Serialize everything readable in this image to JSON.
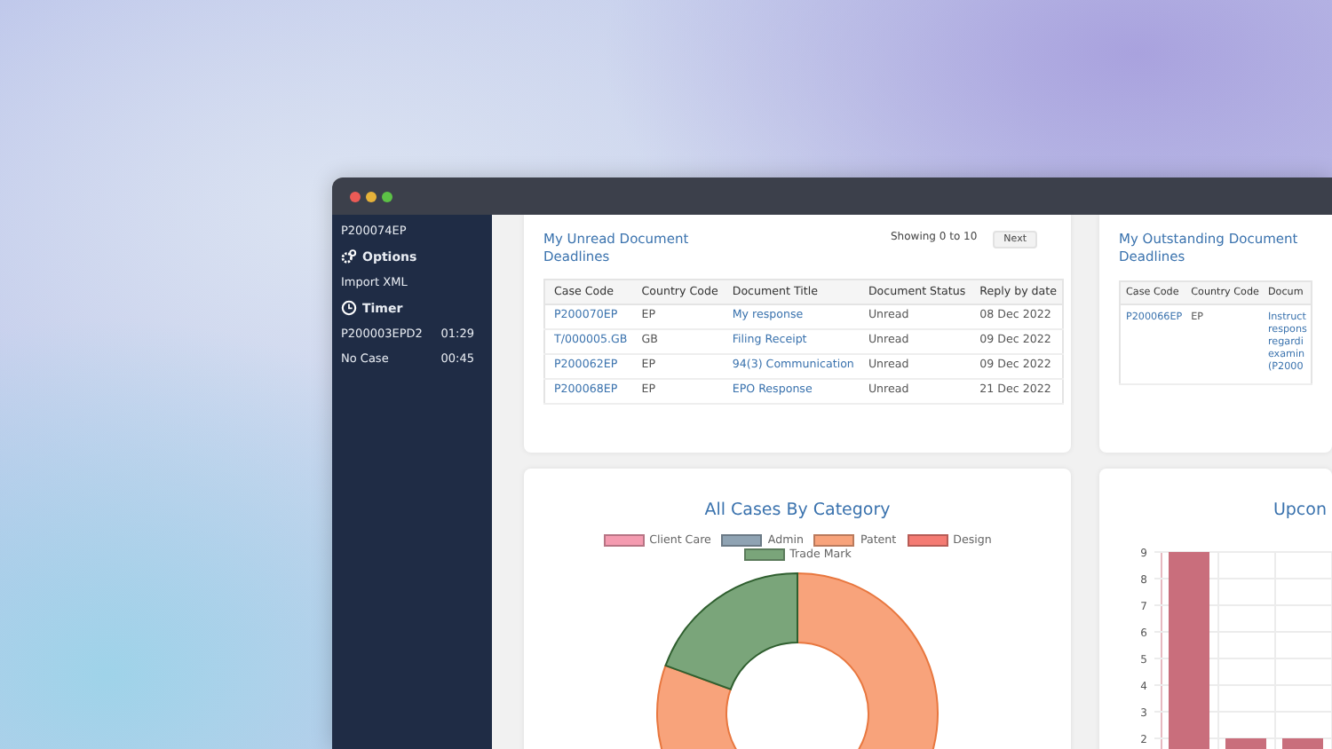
{
  "sidebar": {
    "current_case": "P200074EP",
    "sections": [
      {
        "title": "Options",
        "items": [
          {
            "label": "Import XML"
          }
        ]
      },
      {
        "title": "Timer",
        "items": [
          {
            "label": "P200003EPD2",
            "time": "01:29"
          },
          {
            "label": "No Case",
            "time": "00:45"
          }
        ]
      }
    ]
  },
  "unread_deadlines": {
    "title": "My Unread Document Deadlines",
    "pager": {
      "text": "Showing 0 to 10",
      "button": "Next"
    },
    "columns": [
      {
        "label": "Case Code",
        "kind": "link"
      },
      {
        "label": "Country Code",
        "kind": "text"
      },
      {
        "label": "Document Title",
        "kind": "link"
      },
      {
        "label": "Document Status",
        "kind": "text"
      },
      {
        "label": "Reply by date",
        "kind": "text"
      }
    ],
    "rows": [
      [
        "P200070EP",
        "EP",
        "My response",
        "Unread",
        "08 Dec 2022"
      ],
      [
        "T/000005.GB",
        "GB",
        "Filing Receipt",
        "Unread",
        "09 Dec 2022"
      ],
      [
        "P200062EP",
        "EP",
        "94(3) Communication",
        "Unread",
        "09 Dec 2022"
      ],
      [
        "P200068EP",
        "EP",
        "EPO Response",
        "Unread",
        "21 Dec 2022"
      ]
    ]
  },
  "outstanding_deadlines": {
    "title": "My Outstanding Document Deadlines",
    "columns": [
      {
        "label": "Case Code",
        "kind": "link"
      },
      {
        "label": "Country Code",
        "kind": "text"
      },
      {
        "label": "Docum",
        "kind": "link"
      }
    ],
    "rows": [
      [
        "P200066EP",
        "EP",
        "Instruct\nrespons\nregardi\nexamin\n(P2000"
      ]
    ]
  },
  "category_chart": {
    "title": "All Cases By Category",
    "legend": [
      {
        "label": "Client Care",
        "color": "#f49bb0"
      },
      {
        "label": "Admin",
        "color": "#8fa3b3"
      },
      {
        "label": "Patent",
        "color": "#f8a37b"
      },
      {
        "label": "Design",
        "color": "#f47b73"
      },
      {
        "label": "Trade Mark",
        "color": "#7aa57a"
      }
    ]
  },
  "upcoming_chart": {
    "chart_data": {
      "type": "bar",
      "title": "Upcon",
      "series": [
        {
          "color": "#c96e7c",
          "values": [
            9,
            2,
            2
          ]
        }
      ],
      "yticks": [
        2,
        3,
        4,
        5,
        6,
        7,
        8,
        9
      ],
      "ylim": [
        0,
        9
      ],
      "grid": true
    }
  }
}
